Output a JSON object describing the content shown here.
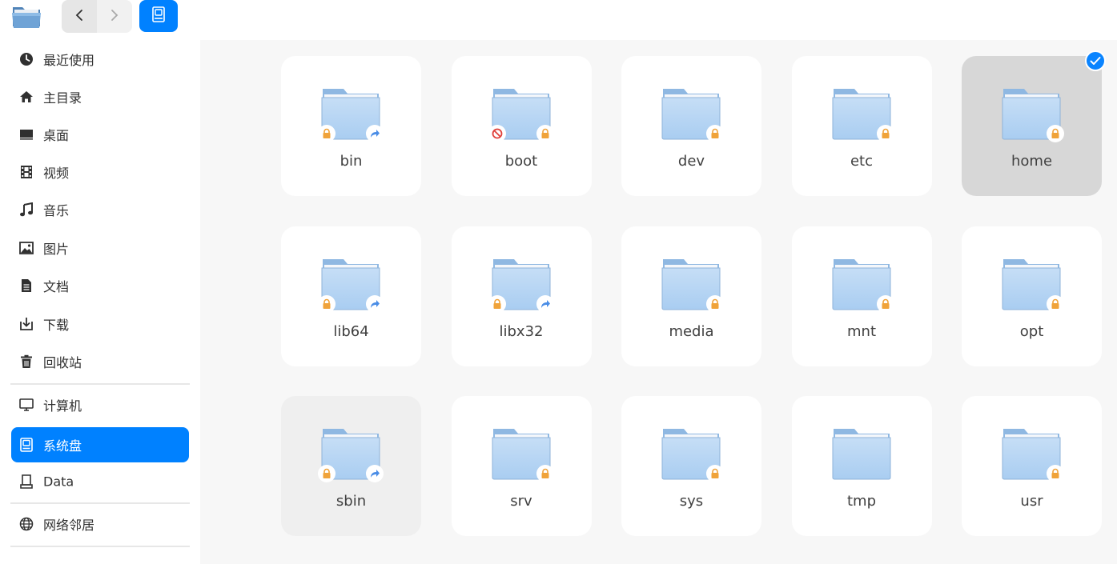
{
  "toolbar": {
    "app_icon": "folder-app-icon",
    "back_icon": "chevron-left-icon",
    "forward_icon": "chevron-right-icon",
    "location_icon": "system-disk-icon",
    "accent": "#0081ff"
  },
  "sidebar": {
    "groups": [
      {
        "items": [
          {
            "key": "recent",
            "label": "最近使用",
            "icon": "clock-icon"
          },
          {
            "key": "home",
            "label": "主目录",
            "icon": "home-icon"
          },
          {
            "key": "desktop",
            "label": "桌面",
            "icon": "desktop-icon"
          },
          {
            "key": "videos",
            "label": "视频",
            "icon": "film-icon"
          },
          {
            "key": "music",
            "label": "音乐",
            "icon": "music-note-icon"
          },
          {
            "key": "pictures",
            "label": "图片",
            "icon": "image-icon"
          },
          {
            "key": "documents",
            "label": "文档",
            "icon": "document-icon"
          },
          {
            "key": "downloads",
            "label": "下载",
            "icon": "download-icon"
          },
          {
            "key": "trash",
            "label": "回收站",
            "icon": "trash-icon"
          }
        ]
      },
      {
        "items": [
          {
            "key": "computer",
            "label": "计算机",
            "icon": "monitor-icon"
          },
          {
            "key": "system-disk",
            "label": "系统盘",
            "icon": "system-disk-icon",
            "active": true
          },
          {
            "key": "data",
            "label": "Data",
            "icon": "drive-icon"
          }
        ]
      },
      {
        "items": [
          {
            "key": "network",
            "label": "网络邻居",
            "icon": "globe-icon"
          }
        ]
      }
    ]
  },
  "folders": [
    {
      "name": "bin",
      "emblems": [
        "lock",
        "symlink"
      ]
    },
    {
      "name": "boot",
      "emblems": [
        "no-access",
        "lock"
      ]
    },
    {
      "name": "dev",
      "emblems": [
        "lock"
      ]
    },
    {
      "name": "etc",
      "emblems": [
        "lock"
      ]
    },
    {
      "name": "home",
      "emblems": [
        "lock"
      ],
      "state": "selected"
    },
    {
      "name": "lib64",
      "emblems": [
        "lock",
        "symlink"
      ]
    },
    {
      "name": "libx32",
      "emblems": [
        "lock",
        "symlink"
      ]
    },
    {
      "name": "media",
      "emblems": [
        "lock"
      ]
    },
    {
      "name": "mnt",
      "emblems": [
        "lock"
      ]
    },
    {
      "name": "opt",
      "emblems": [
        "lock"
      ]
    },
    {
      "name": "sbin",
      "emblems": [
        "lock",
        "symlink"
      ],
      "state": "hover"
    },
    {
      "name": "srv",
      "emblems": [
        "lock"
      ]
    },
    {
      "name": "sys",
      "emblems": [
        "lock"
      ]
    },
    {
      "name": "tmp",
      "emblems": []
    },
    {
      "name": "usr",
      "emblems": [
        "lock"
      ]
    }
  ],
  "colors": {
    "folder_body": "#a9cdf1",
    "lock": "#f0a33a",
    "symlink": "#4a8de6",
    "no_access": "#e0403a",
    "check": "#0a84ff"
  }
}
